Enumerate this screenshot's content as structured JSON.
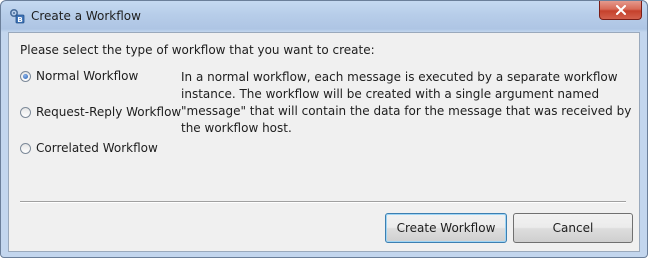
{
  "window": {
    "title": "Create a Workflow",
    "app_icon": "workflow-app-icon",
    "close_icon": "close-icon"
  },
  "dialog": {
    "prompt": "Please select the type of workflow that you want to create:",
    "options": [
      {
        "label": "Normal Workflow",
        "selected": true
      },
      {
        "label": "Request-Reply Workflow",
        "selected": false
      },
      {
        "label": "Correlated Workflow",
        "selected": false
      }
    ],
    "description": "In a normal workflow, each message is executed by a separate workflow instance. The workflow will be created with a single argument named \"message\" that will contain the data for the message that was received by the workflow host."
  },
  "buttons": {
    "create_label": "Create Workflow",
    "cancel_label": "Cancel"
  },
  "colors": {
    "title_bar": "#b7cde9",
    "close_button": "#c5412c",
    "dialog_background": "#f0f0f0",
    "default_button_border": "#3c7fb1"
  }
}
